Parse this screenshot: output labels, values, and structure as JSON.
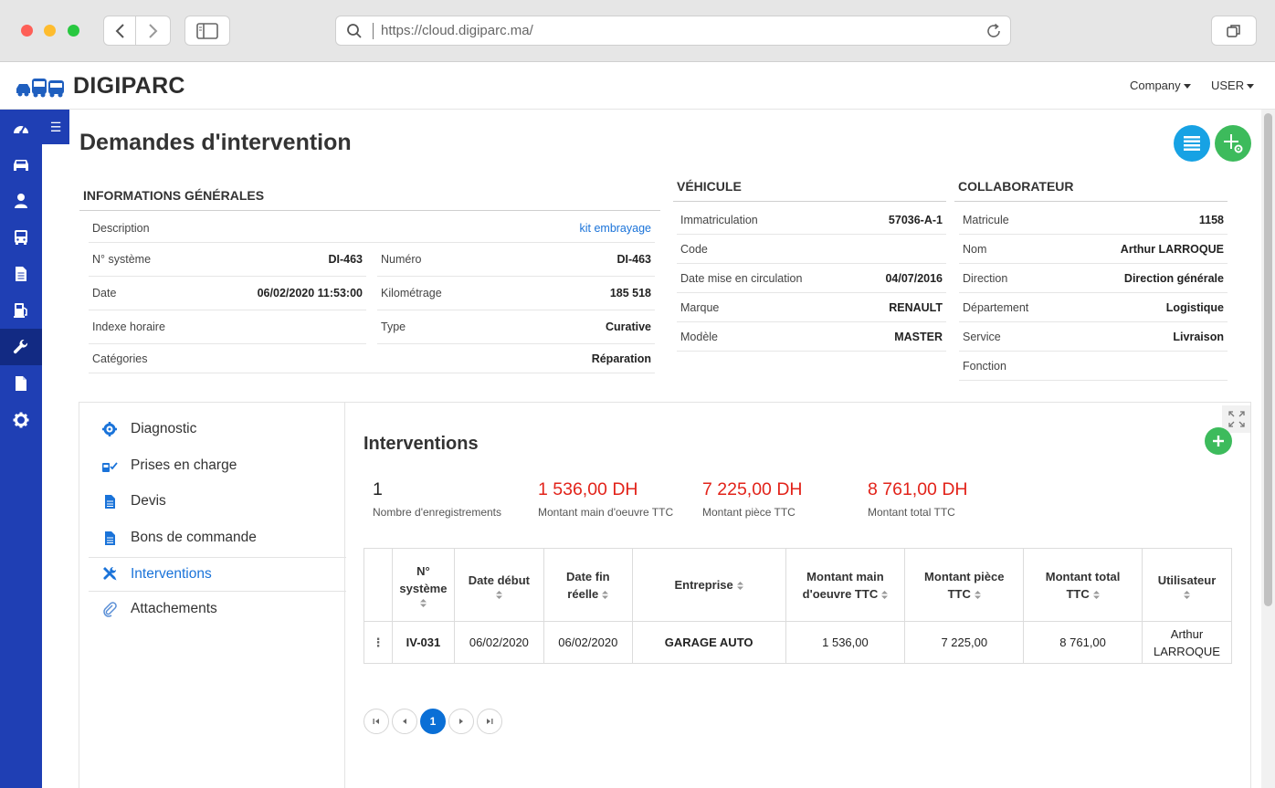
{
  "browser": {
    "url": "https://cloud.digiparc.ma/"
  },
  "header": {
    "brand": "DIGIPARC",
    "company_menu": "Company",
    "user_menu": "USER"
  },
  "sidebar": {
    "items": [
      {
        "icon": "dashboard-icon",
        "active": false
      },
      {
        "icon": "car-icon",
        "active": false
      },
      {
        "icon": "user-icon",
        "active": false
      },
      {
        "icon": "bus-icon",
        "active": false
      },
      {
        "icon": "document-icon",
        "active": false
      },
      {
        "icon": "fuel-icon",
        "active": false
      },
      {
        "icon": "wrench-icon",
        "active": true
      },
      {
        "icon": "files-icon",
        "active": false
      },
      {
        "icon": "gear-icon",
        "active": false
      }
    ],
    "toggle": "☰"
  },
  "page": {
    "title": "Demandes d'intervention"
  },
  "general": {
    "title": "INFORMATIONS GÉNÉRALES",
    "description_label": "Description",
    "description_value": "kit embrayage",
    "left": [
      {
        "label": "N° système",
        "value": "DI-463"
      },
      {
        "label": "Date",
        "value": "06/02/2020 11:53:00"
      },
      {
        "label": "Indexe horaire",
        "value": ""
      }
    ],
    "right": [
      {
        "label": "Numéro",
        "value": "DI-463"
      },
      {
        "label": "Kilométrage",
        "value": "185 518"
      },
      {
        "label": "Type",
        "value": "Curative"
      }
    ],
    "categories_label": "Catégories",
    "categories_value": "Réparation"
  },
  "vehicle": {
    "title": "VÉHICULE",
    "rows": [
      {
        "label": "Immatriculation",
        "value": "57036-A-1"
      },
      {
        "label": "Code",
        "value": ""
      },
      {
        "label": "Date mise en circulation",
        "value": "04/07/2016"
      },
      {
        "label": "Marque",
        "value": "RENAULT"
      },
      {
        "label": "Modèle",
        "value": "MASTER"
      }
    ]
  },
  "collaborator": {
    "title": "COLLABORATEUR",
    "rows": [
      {
        "label": "Matricule",
        "value": "1158"
      },
      {
        "label": "Nom",
        "value": "Arthur LARROQUE"
      },
      {
        "label": "Direction",
        "value": "Direction générale"
      },
      {
        "label": "Département",
        "value": "Logistique"
      },
      {
        "label": "Service",
        "value": "Livraison"
      },
      {
        "label": "Fonction",
        "value": ""
      }
    ]
  },
  "tabs": [
    {
      "label": "Diagnostic",
      "icon": "diagnostic-gear-icon"
    },
    {
      "label": "Prises en charge",
      "icon": "pump-check-icon"
    },
    {
      "label": "Devis",
      "icon": "file-icon"
    },
    {
      "label": "Bons de commande",
      "icon": "file-icon"
    },
    {
      "label": "Interventions",
      "icon": "tools-icon"
    },
    {
      "label": "Attachements",
      "icon": "paperclip-icon"
    }
  ],
  "interventions": {
    "title": "Interventions",
    "stats": [
      {
        "value": "1",
        "label": "Nombre d'enregistrements"
      },
      {
        "value": "1 536,00 DH",
        "label": "Montant main d'oeuvre TTC"
      },
      {
        "value": "7 225,00 DH",
        "label": "Montant pièce TTC"
      },
      {
        "value": "8 761,00 DH",
        "label": "Montant total TTC"
      }
    ],
    "columns": [
      {
        "l1": "N°",
        "l2": "système"
      },
      {
        "l1": "Date début",
        "l2": ""
      },
      {
        "l1": "Date fin",
        "l2": "réelle"
      },
      {
        "l1": "Entreprise",
        "l2": ""
      },
      {
        "l1": "Montant main",
        "l2": "d'oeuvre TTC"
      },
      {
        "l1": "Montant pièce",
        "l2": "TTC"
      },
      {
        "l1": "Montant total",
        "l2": "TTC"
      },
      {
        "l1": "Utilisateur",
        "l2": ""
      }
    ],
    "rows": [
      {
        "menu": "⋮",
        "system": "IV-031",
        "date_debut": "06/02/2020",
        "date_fin": "06/02/2020",
        "entreprise": "GARAGE AUTO",
        "main_oeuvre": "1 536,00",
        "piece": "7 225,00",
        "total": "8 761,00",
        "user_l1": "Arthur",
        "user_l2": "LARROQUE"
      }
    ],
    "pager": {
      "current": "1"
    }
  }
}
